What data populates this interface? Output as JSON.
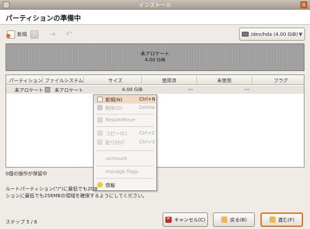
{
  "window": {
    "title": "インストール"
  },
  "header": {
    "title": "パーティションの準備中"
  },
  "toolbar": {
    "new_label": "新規"
  },
  "device_select": {
    "value": "/dev/hda (4.00 GiB)"
  },
  "disk": {
    "label_line1": "未アロケート",
    "label_line2": "4.00 GiB",
    "fill_color": "#9f9f9f"
  },
  "table": {
    "headers": [
      "パーティション",
      "ファイルシステム",
      "サイズ",
      "使用済",
      "未使用",
      "フラグ"
    ],
    "rows": [
      {
        "partition": "未アロケート",
        "filesystem": "未アロケート",
        "size": "4.00 GiB",
        "used": "---",
        "unused": "---",
        "flags": ""
      }
    ]
  },
  "context_menu": {
    "items": [
      {
        "label": "新規(N)",
        "accel": "Ctrl+N",
        "enabled": true,
        "highlighted": true,
        "icon": "new-icon"
      },
      {
        "label": "削除(D)",
        "accel": "Delete",
        "enabled": false,
        "icon": "delete-icon"
      },
      {
        "label": "Resize/Move",
        "accel": "",
        "enabled": false,
        "icon": "resize-icon"
      },
      {
        "label": "コピー(C)",
        "accel": "Ctrl+C",
        "enabled": false,
        "icon": "copy-icon"
      },
      {
        "label": "貼り付け",
        "accel": "Ctrl+V",
        "enabled": false,
        "icon": "paste-icon"
      },
      {
        "label": "unmount",
        "accel": "",
        "enabled": false
      },
      {
        "label": "manage flags",
        "accel": "",
        "enabled": false
      },
      {
        "label": "情報",
        "accel": "",
        "enabled": true,
        "icon": "info-icon"
      }
    ]
  },
  "status": {
    "pending": "0個の操作が保留中",
    "warning_line1": "ルートパーティション(\"/\")に最低でも2GB",
    "warning_line2": "ションに最低でも256MBの領域を確保するようにしてください。",
    "step": "ステップ 5 / 6"
  },
  "buttons": {
    "cancel": "キャンセル(C)",
    "back": "戻る(B)",
    "forward": "進む(F)"
  },
  "colors": {
    "accent": "#e0761e",
    "selection": "#e7e3de",
    "menu_highlight": "#f1d8be"
  }
}
